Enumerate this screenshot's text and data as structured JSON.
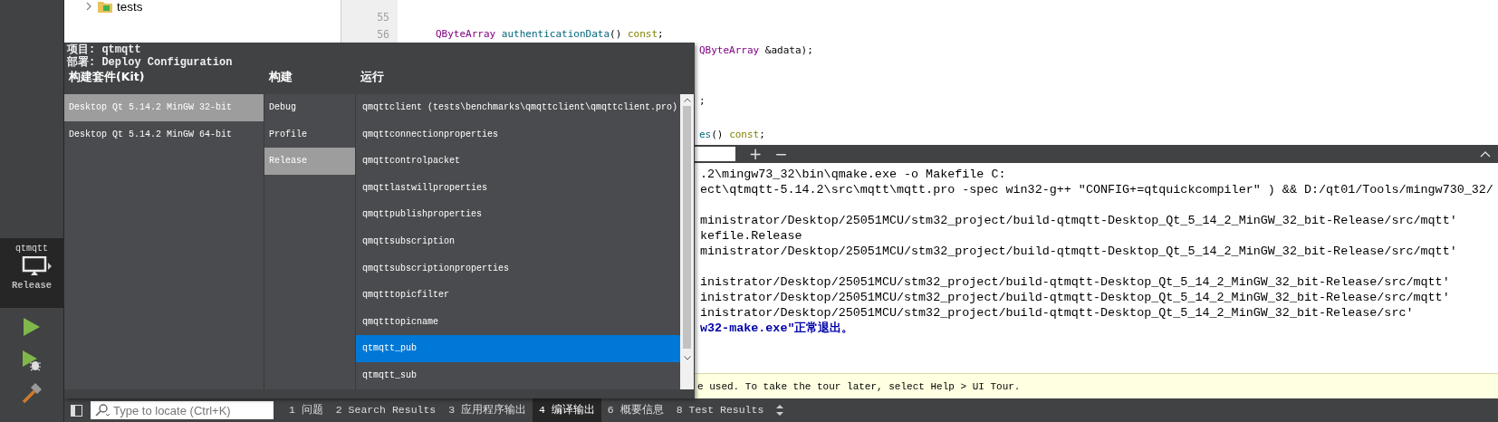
{
  "mode_bar": {
    "kit_selector": {
      "project": "qtmqtt",
      "build": "Release"
    }
  },
  "project_tree": {
    "items": [
      {
        "label": "tests",
        "expanded": false
      }
    ]
  },
  "editor": {
    "lines": [
      {
        "number": "55",
        "kind": "full"
      },
      {
        "number": "56",
        "kind": "full",
        "tokens": [
          {
            "text": "QByteArray ",
            "kind": "type"
          },
          {
            "text": "authenticationData",
            "kind": "func"
          },
          {
            "text": "() ",
            "kind": "plain"
          },
          {
            "text": "const",
            "kind": "keyword"
          },
          {
            "text": ";",
            "kind": "plain"
          }
        ]
      },
      {
        "kind": "clipped",
        "tokens": [
          {
            "text": "QByteArray",
            "kind": "type"
          },
          {
            "text": " &adata);",
            "kind": "plain"
          }
        ]
      },
      {
        "kind": "clipped"
      },
      {
        "kind": "clipped"
      },
      {
        "kind": "clipped",
        "tokens": [
          {
            "text": ";",
            "kind": "plain"
          }
        ]
      },
      {
        "kind": "clipped"
      },
      {
        "kind": "clipped",
        "tokens": [
          {
            "text": "es",
            "kind": "func"
          },
          {
            "text": "() ",
            "kind": "plain"
          },
          {
            "text": "const",
            "kind": "keyword"
          },
          {
            "text": ";",
            "kind": "plain"
          }
        ]
      }
    ]
  },
  "output": {
    "buttons": [
      "+",
      "−"
    ],
    "lines": [
      {
        "kind": "normal",
        "text": ".2\\mingw73_32\\bin\\qmake.exe -o Makefile C:"
      },
      {
        "kind": "normal",
        "text": "ect\\qtmqtt-5.14.2\\src\\mqtt\\mqtt.pro -spec win32-g++ \"CONFIG+=qtquickcompiler\" ) && D:/qt01/Tools/mingw730_32/"
      },
      {
        "kind": "blank"
      },
      {
        "kind": "normal",
        "text": "ministrator/Desktop/25051MCU/stm32_project/build-qtmqtt-Desktop_Qt_5_14_2_MinGW_32_bit-Release/src/mqtt'"
      },
      {
        "kind": "normal",
        "text": "kefile.Release"
      },
      {
        "kind": "normal",
        "text": "ministrator/Desktop/25051MCU/stm32_project/build-qtmqtt-Desktop_Qt_5_14_2_MinGW_32_bit-Release/src/mqtt'"
      },
      {
        "kind": "blank"
      },
      {
        "kind": "normal",
        "text": "inistrator/Desktop/25051MCU/stm32_project/build-qtmqtt-Desktop_Qt_5_14_2_MinGW_32_bit-Release/src/mqtt'"
      },
      {
        "kind": "normal",
        "text": "inistrator/Desktop/25051MCU/stm32_project/build-qtmqtt-Desktop_Qt_5_14_2_MinGW_32_bit-Release/src/mqtt'"
      },
      {
        "kind": "normal",
        "text": "inistrator/Desktop/25051MCU/stm32_project/build-qtmqtt-Desktop_Qt_5_14_2_MinGW_32_bit-Release/src'"
      },
      {
        "kind": "success",
        "text": "w32-make.exe\"正常退出。"
      }
    ]
  },
  "info_bar": {
    "text": "e used. To take the tour later, select Help > UI Tour."
  },
  "kit_popup": {
    "project_line": "项目: qtmqtt",
    "deploy_line": "部署: Deploy Configuration",
    "columns": [
      {
        "heading": "构建套件(Kit)",
        "items": [
          {
            "label": "Desktop Qt 5.14.2 MinGW 32-bit",
            "selected": true
          },
          {
            "label": "Desktop Qt 5.14.2 MinGW 64-bit",
            "selected": false
          }
        ]
      },
      {
        "heading": "构建",
        "items": [
          {
            "label": "Debug",
            "selected": false
          },
          {
            "label": "Profile",
            "selected": false
          },
          {
            "label": "Release",
            "selected": true
          }
        ]
      },
      {
        "heading": "运行",
        "items": [
          {
            "label": "qmqttclient (tests\\benchmarks\\qmqttclient\\qmqttclient.pro)",
            "selected": false
          },
          {
            "label": "qmqttconnectionproperties",
            "selected": false
          },
          {
            "label": "qmqttcontrolpacket",
            "selected": false
          },
          {
            "label": "qmqttlastwillproperties",
            "selected": false
          },
          {
            "label": "qmqttpublishproperties",
            "selected": false
          },
          {
            "label": "qmqttsubscription",
            "selected": false
          },
          {
            "label": "qmqttsubscriptionproperties",
            "selected": false
          },
          {
            "label": "qmqtttopicfilter",
            "selected": false
          },
          {
            "label": "qmqtttopicname",
            "selected": false
          },
          {
            "label": "qtmqtt_pub",
            "selected": true
          },
          {
            "label": "qtmqtt_sub",
            "selected": false
          }
        ]
      }
    ]
  },
  "status_bar": {
    "locate_placeholder": "Type to locate (Ctrl+K)",
    "tabs": [
      {
        "label": "1 问题",
        "selected": false
      },
      {
        "label": "2 Search Results",
        "selected": false
      },
      {
        "label": "3 应用程序输出",
        "selected": false
      },
      {
        "label": "4 编译输出",
        "selected": true
      },
      {
        "label": "6 概要信息",
        "selected": false
      },
      {
        "label": "8 Test Results",
        "selected": false
      }
    ]
  }
}
